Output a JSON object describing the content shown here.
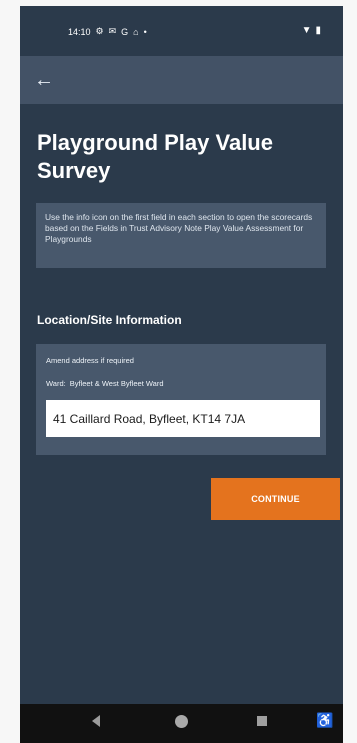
{
  "status": {
    "time": "14:10",
    "icons_left": [
      "settings-icon",
      "mail-icon",
      "google-icon",
      "lock-icon"
    ],
    "signal_dot": "•",
    "icons_right": [
      "wifi-icon",
      "battery-icon"
    ]
  },
  "app_bar": {
    "back_icon": "arrow-back-icon"
  },
  "page": {
    "title": "Playground Play Value Survey",
    "info": "Use the info icon on the first field in each section to open the scorecards based on the Fields in Trust Advisory Note Play Value Assessment for Playgrounds",
    "section_title": "Location/Site Information",
    "address_card": {
      "amend_label": "Amend address if required",
      "ward_label": "Ward:",
      "ward_value": "Byfleet & West Byfleet Ward",
      "address_value": "41 Caillard Road, Byfleet, KT14 7JA"
    },
    "continue_label": "CONTINUE"
  },
  "colors": {
    "background": "#2b3a4b",
    "panel": "#48586c",
    "accent": "#e4731e",
    "text": "#ffffff"
  },
  "nav": {
    "back_icon": "back-icon",
    "home_icon": "home-icon",
    "recent_icon": "recent-apps-icon",
    "accessibility_icon": "accessibility-icon"
  }
}
